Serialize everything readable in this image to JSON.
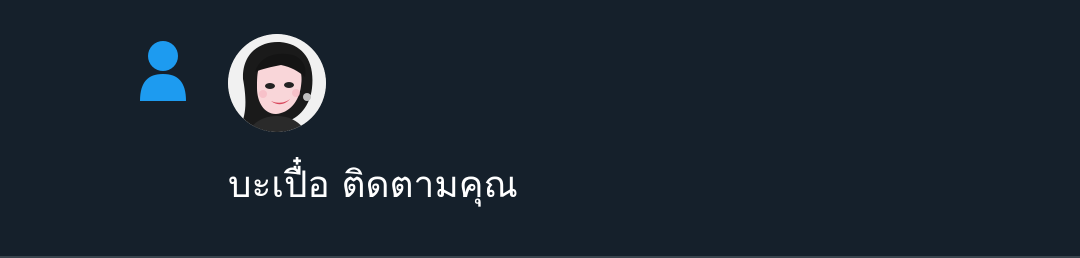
{
  "notification": {
    "type_icon": "person-icon",
    "avatar_icon": "user-avatar",
    "text": "บะเปื๋อ ติดตามคุณ"
  },
  "colors": {
    "background": "#15202b",
    "accent": "#1d9bf0",
    "text": "#ffffff",
    "divider": "#38444d"
  }
}
